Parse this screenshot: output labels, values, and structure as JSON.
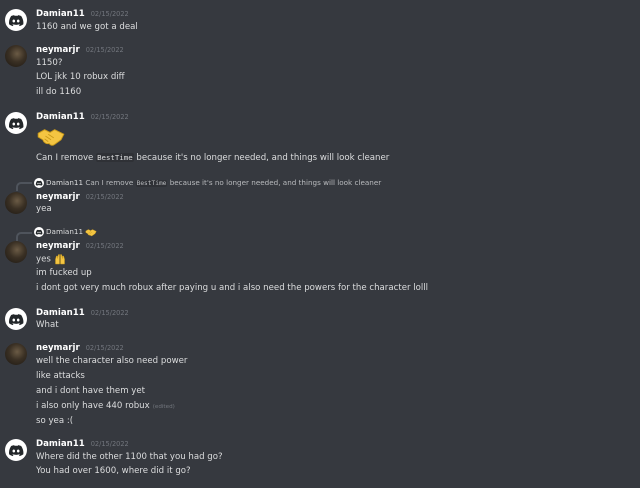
{
  "messages": [
    {
      "author": "Damian11",
      "time": "02/15/2022",
      "lines": [
        "1160 and we got a deal"
      ]
    },
    {
      "author": "neymarjr",
      "time": "02/15/2022",
      "lines": [
        "1150?",
        "LOL jkk 10 robux diff",
        "ill do 1160"
      ]
    },
    {
      "author": "Damian11",
      "time": "02/15/2022",
      "sticker": "handshake-emoji",
      "line_pre": "Can I remove ",
      "line_code": "BestTime",
      "line_post": " because it's no longer needed, and things will look cleaner"
    },
    {
      "reply_author": "Damian11",
      "reply_pre": "Can I remove ",
      "reply_code": "BestTime",
      "reply_post": " because it's no longer needed, and things will look cleaner",
      "author": "neymarjr",
      "time": "02/15/2022",
      "lines": [
        "yea"
      ]
    },
    {
      "reply_author": "Damian11",
      "reply_emoji": "handshake-emoji",
      "author": "neymarjr",
      "time": "02/15/2022",
      "first_line": "yes",
      "first_emoji": "raised-hands-emoji",
      "lines": [
        "im fucked up",
        "i dont got very much robux after paying u and i also need the powers for the character lolll"
      ]
    },
    {
      "author": "Damian11",
      "time": "02/15/2022",
      "lines": [
        "What"
      ]
    },
    {
      "author": "neymarjr",
      "time": "02/15/2022",
      "lines": [
        "well the character also need power",
        "like attacks",
        "and i dont have them yet",
        "i also only have 440 robux",
        "so yea :("
      ],
      "edited_label": "(edited)"
    },
    {
      "author": "Damian11",
      "time": "02/15/2022",
      "lines": [
        "Where did the other 1100 that you had go?",
        "You had over 1600, where did it go?"
      ]
    }
  ],
  "colors": {
    "background": "#36393f",
    "text": "#dcddde",
    "timestamp": "#72767d",
    "username": "#ffffff"
  }
}
